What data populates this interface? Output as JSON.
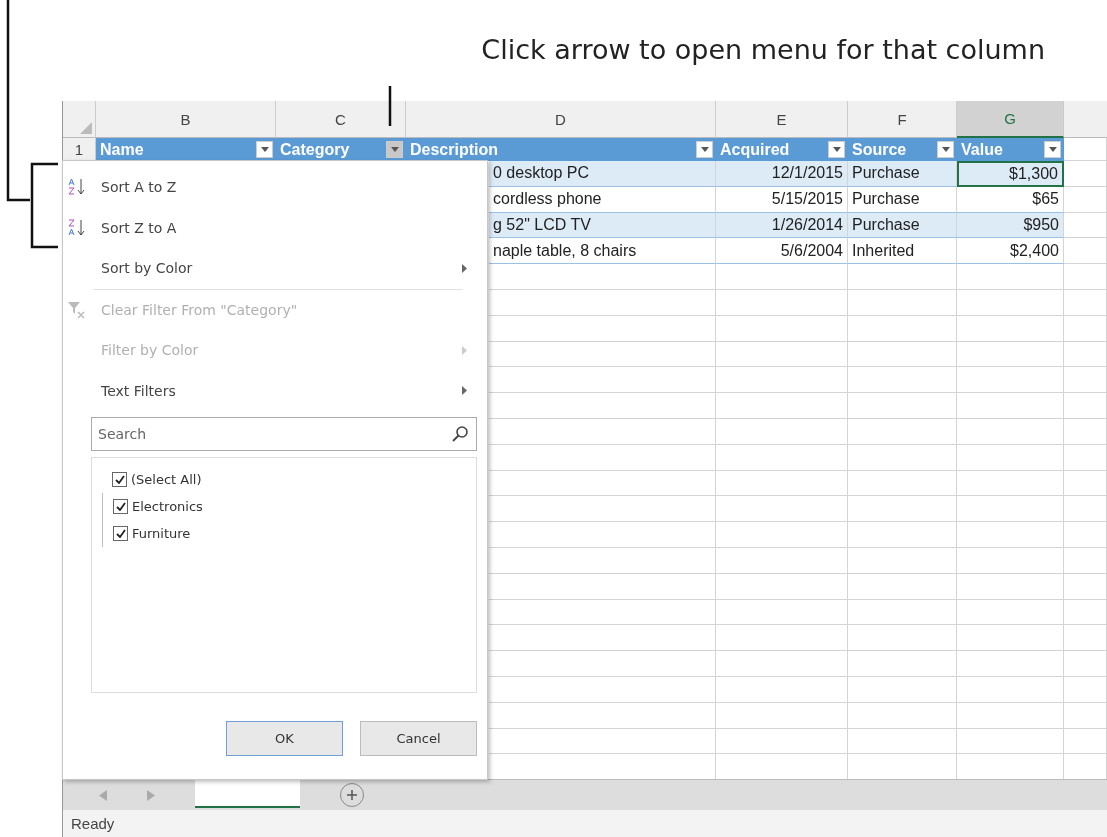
{
  "annotation": {
    "text": "Click arrow to open menu for that column"
  },
  "column_letters": [
    {
      "label": "B",
      "selected": false
    },
    {
      "label": "C",
      "selected": false
    },
    {
      "label": "D",
      "selected": false
    },
    {
      "label": "E",
      "selected": false
    },
    {
      "label": "F",
      "selected": false
    },
    {
      "label": "G",
      "selected": true
    }
  ],
  "header_row": {
    "number": "1",
    "columns": [
      {
        "label": "Name",
        "open": false
      },
      {
        "label": "Category",
        "open": true
      },
      {
        "label": "Description",
        "open": false
      },
      {
        "label": "Acquired",
        "open": false
      },
      {
        "label": "Source",
        "open": false
      },
      {
        "label": "Value",
        "open": false
      }
    ]
  },
  "rows": [
    {
      "description": "0 desktop PC",
      "acquired": "12/1/2015",
      "source": "Purchase",
      "value": {
        "text": "$1,300",
        "selected": true
      }
    },
    {
      "description": "cordless phone",
      "acquired": "5/15/2015",
      "source": "Purchase",
      "value": {
        "text": "$65",
        "selected": false
      }
    },
    {
      "description": "g 52\" LCD TV",
      "acquired": "1/26/2014",
      "source": "Purchase",
      "value": {
        "text": "$950",
        "selected": false
      }
    },
    {
      "description": "naple table, 8 chairs",
      "acquired": "5/6/2004",
      "source": "Inherited",
      "value": {
        "text": "$2,400",
        "selected": false
      }
    }
  ],
  "filter_menu": {
    "items": [
      {
        "kind": "item",
        "label": "Sort A to Z",
        "disabled": false,
        "submenu": false
      },
      {
        "kind": "item",
        "label": "Sort Z to A",
        "disabled": false,
        "submenu": false
      },
      {
        "kind": "item",
        "label": "Sort by Color",
        "disabled": false,
        "submenu": true
      },
      {
        "kind": "separator"
      },
      {
        "kind": "item",
        "label": "Clear Filter From \"Category\"",
        "disabled": true,
        "submenu": false
      },
      {
        "kind": "item",
        "label": "Filter by Color",
        "disabled": true,
        "submenu": true
      },
      {
        "kind": "item",
        "label": "Text Filters",
        "disabled": false,
        "submenu": true
      }
    ],
    "search": {
      "placeholder": "Search"
    },
    "values": [
      {
        "label": "(Select All)",
        "checked": true,
        "children": [
          {
            "label": "Electronics",
            "checked": true
          },
          {
            "label": "Furniture",
            "checked": true
          }
        ]
      }
    ],
    "buttons": [
      {
        "label": "OK",
        "default": true
      },
      {
        "label": "Cancel",
        "default": false
      }
    ]
  },
  "status_bar": {
    "text": "Ready"
  }
}
